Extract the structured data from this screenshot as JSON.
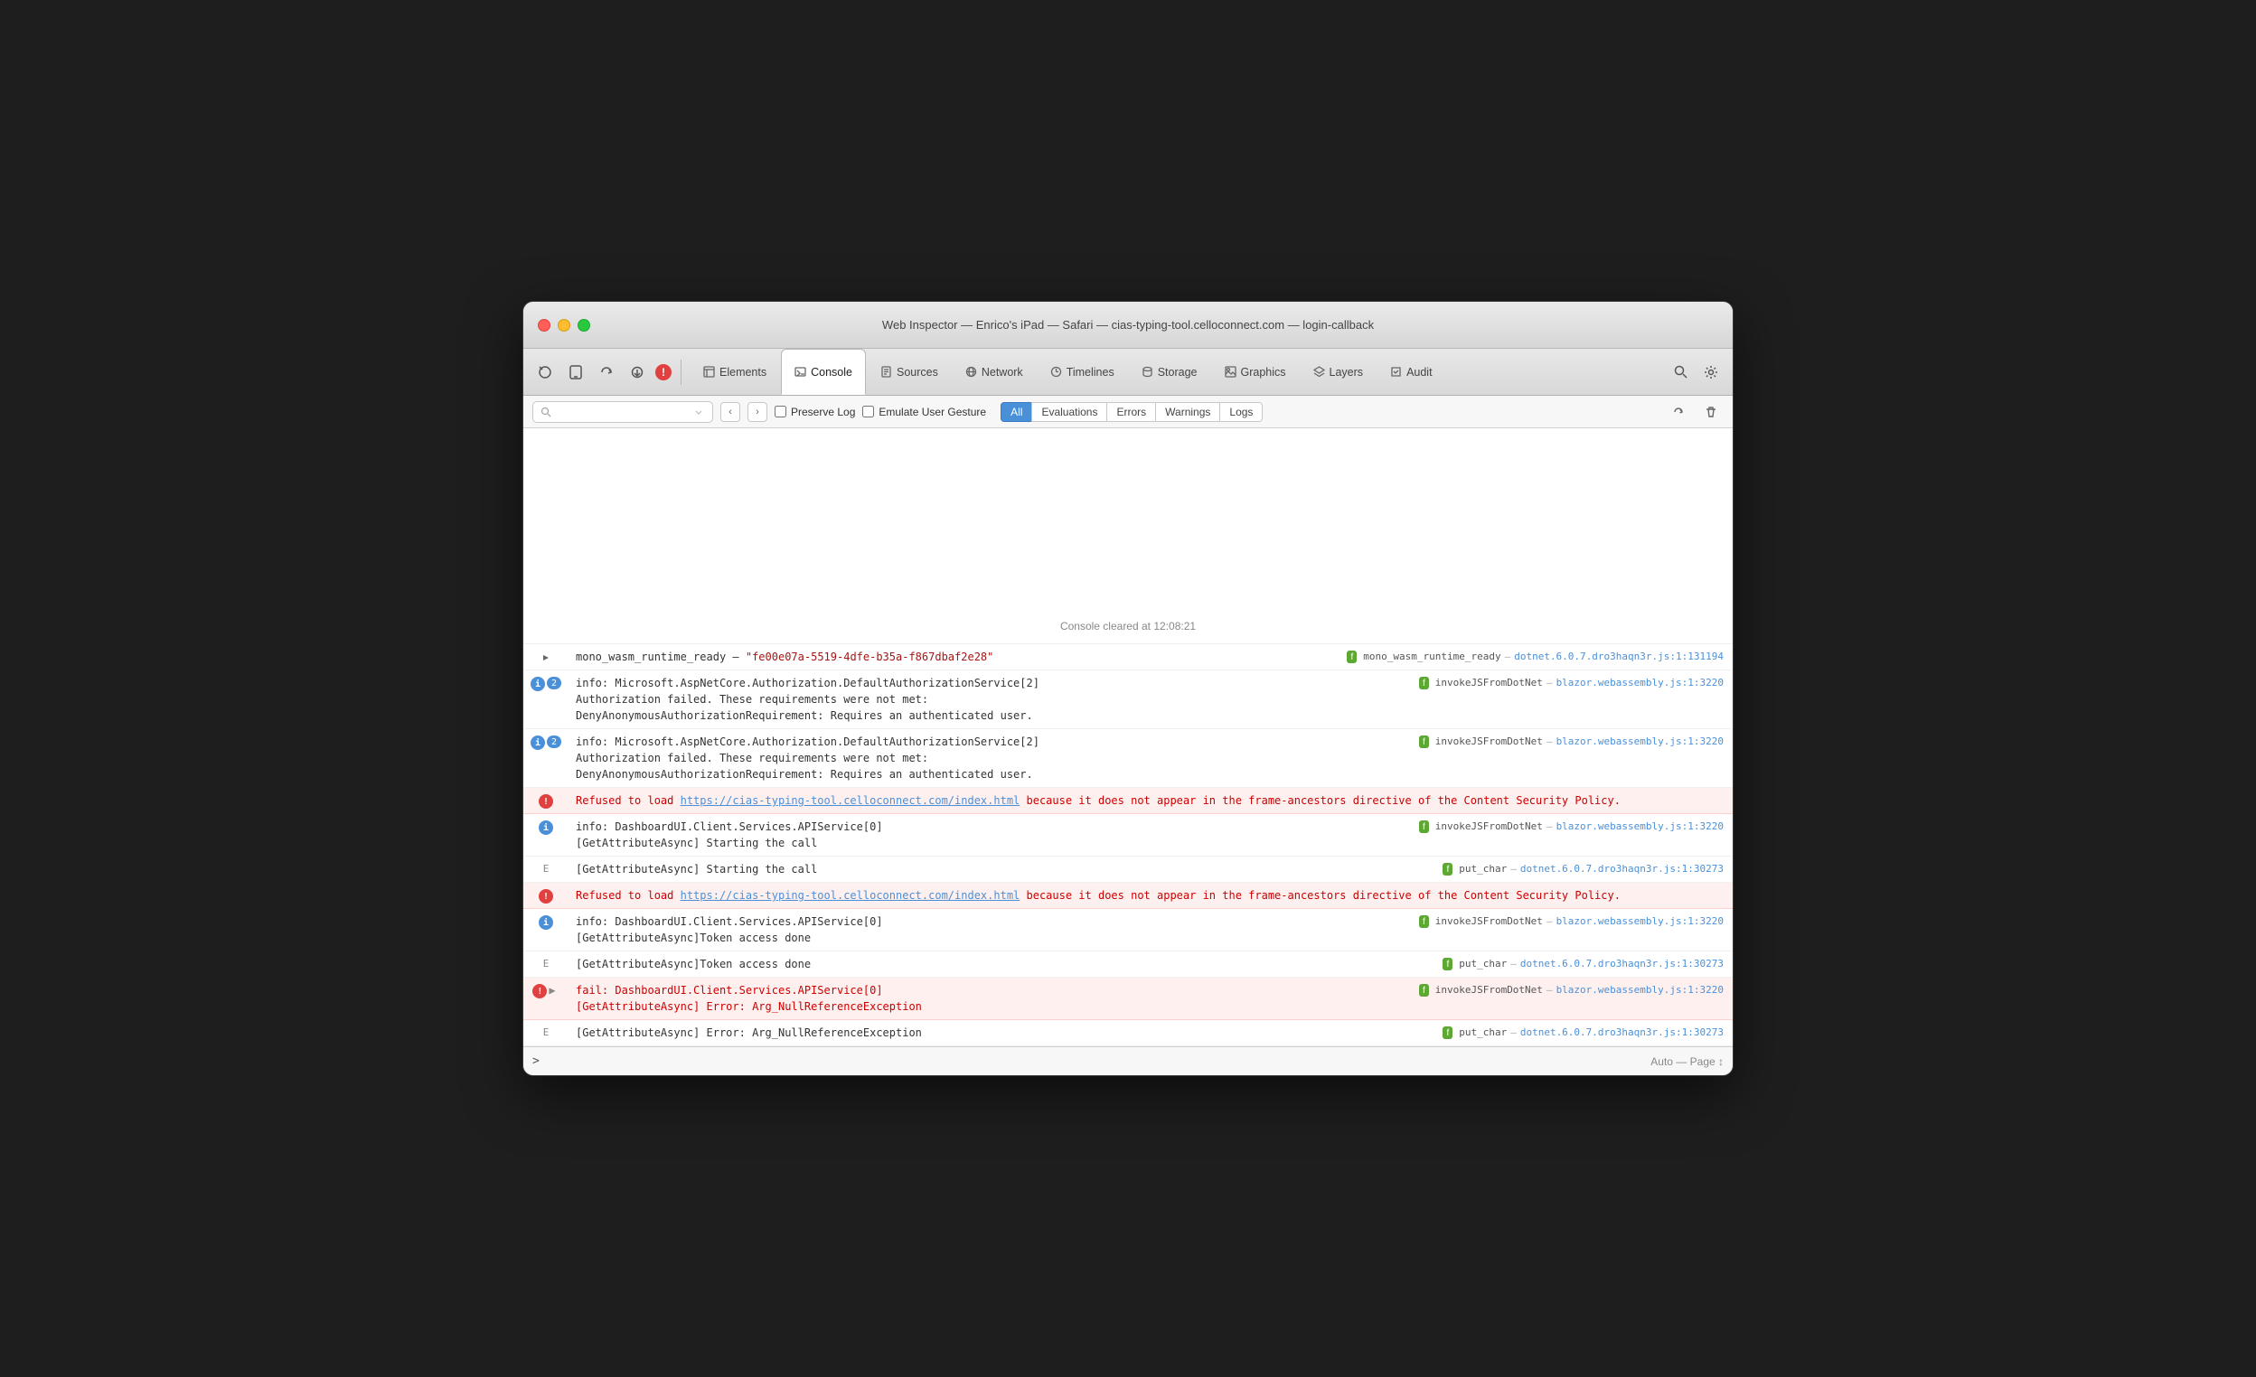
{
  "window": {
    "title": "Web Inspector — Enrico's iPad — Safari — cias-typing-tool.celloconnect.com — login-callback"
  },
  "toolbar": {
    "icons": [
      "⊕",
      "◻",
      "↺",
      "↓"
    ],
    "tabs": [
      {
        "id": "elements",
        "label": "Elements",
        "icon": "◻"
      },
      {
        "id": "console",
        "label": "Console",
        "icon": "◻",
        "active": true
      },
      {
        "id": "sources",
        "label": "Sources",
        "icon": "◻"
      },
      {
        "id": "network",
        "label": "Network",
        "icon": "◻"
      },
      {
        "id": "timelines",
        "label": "Timelines",
        "icon": "◻"
      },
      {
        "id": "storage",
        "label": "Storage",
        "icon": "◻"
      },
      {
        "id": "graphics",
        "label": "Graphics",
        "icon": "◻"
      },
      {
        "id": "layers",
        "label": "Layers",
        "icon": "◻"
      },
      {
        "id": "audit",
        "label": "Audit",
        "icon": "◻"
      }
    ]
  },
  "console_toolbar": {
    "search_placeholder": "",
    "preserve_log_label": "Preserve Log",
    "emulate_gesture_label": "Emulate User Gesture",
    "filter_buttons": [
      "All",
      "Evaluations",
      "Errors",
      "Warnings",
      "Logs"
    ],
    "active_filter": "All"
  },
  "console": {
    "cleared_message": "Console cleared at 12:08:21",
    "rows": [
      {
        "type": "log",
        "icon": "arrow",
        "content": "mono_wasm_runtime_ready — \"fe00e07a-5519-4dfe-b35a-f867dbaf2e28\"",
        "source_tag": "f",
        "source_fn": "mono_wasm_runtime_ready",
        "source_file": "dotnet.6.0.7.dro3haqn3r.js:1:131194"
      },
      {
        "type": "info",
        "badge": "2",
        "content_lines": [
          "info: Microsoft.AspNetCore.Authorization.DefaultAuthorizationService[2]",
          "      Authorization failed. These requirements were not met:",
          "      DenyAnonymousAuthorizationRequirement: Requires an authenticated user."
        ],
        "source_tag": "f",
        "source_fn": "invokeJSFromDotNet",
        "source_file": "blazor.webassembly.js:1:3220"
      },
      {
        "type": "info",
        "badge": "2",
        "content_lines": [
          "info: Microsoft.AspNetCore.Authorization.DefaultAuthorizationService[2]",
          "      Authorization failed. These requirements were not met:",
          "      DenyAnonymousAuthorizationRequirement: Requires an authenticated user."
        ],
        "source_tag": "f",
        "source_fn": "invokeJSFromDotNet",
        "source_file": "blazor.webassembly.js:1:3220"
      },
      {
        "type": "error",
        "content": "Refused to load https://cias-typing-tool.celloconnect.com/index.html because it does not appear in the frame-ancestors directive of the Content Security Policy.",
        "link": "https://cias-typing-tool.celloconnect.com/index.html"
      },
      {
        "type": "info",
        "content_lines": [
          "info: DashboardUI.Client.Services.APIService[0]",
          "      [GetAttributeAsync] Starting the call"
        ],
        "source_tag": "f",
        "source_fn": "invokeJSFromDotNet",
        "source_file": "blazor.webassembly.js:1:3220"
      },
      {
        "type": "trace",
        "content": "[GetAttributeAsync] Starting the call",
        "source_tag": "f",
        "source_fn": "put_char",
        "source_file": "dotnet.6.0.7.dro3haqn3r.js:1:30273"
      },
      {
        "type": "error",
        "content": "Refused to load https://cias-typing-tool.celloconnect.com/index.html because it does not appear in the frame-ancestors directive of the Content Security Policy.",
        "link": "https://cias-typing-tool.celloconnect.com/index.html"
      },
      {
        "type": "info",
        "content_lines": [
          "info: DashboardUI.Client.Services.APIService[0]",
          "      [GetAttributeAsync]Token access done"
        ],
        "source_tag": "f",
        "source_fn": "invokeJSFromDotNet",
        "source_file": "blazor.webassembly.js:1:3220"
      },
      {
        "type": "trace",
        "content": "[GetAttributeAsync]Token access done",
        "source_tag": "f",
        "source_fn": "put_char",
        "source_file": "dotnet.6.0.7.dro3haqn3r.js:1:30273"
      },
      {
        "type": "error_expandable",
        "content_lines": [
          "fail: DashboardUI.Client.Services.APIService[0]",
          "      [GetAttributeAsync] Error: Arg_NullReferenceException"
        ],
        "source_tag": "f",
        "source_fn": "invokeJSFromDotNet",
        "source_file": "blazor.webassembly.js:1:3220"
      },
      {
        "type": "trace",
        "content": "[GetAttributeAsync] Error: Arg_NullReferenceException",
        "source_tag": "f",
        "source_fn": "put_char",
        "source_file": "dotnet.6.0.7.dro3haqn3r.js:1:30273"
      }
    ]
  },
  "bottom_bar": {
    "prompt": ">",
    "auto_label": "Auto — Page ↕"
  }
}
